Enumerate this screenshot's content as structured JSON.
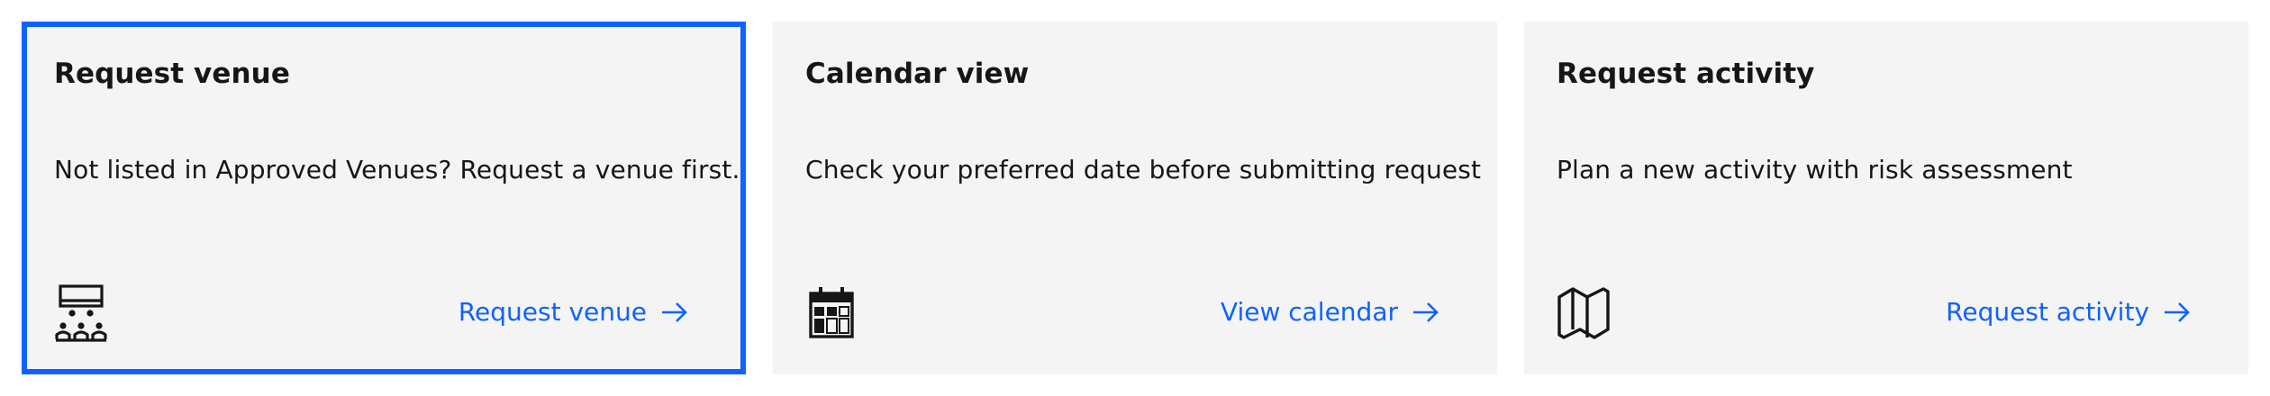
{
  "tiles": [
    {
      "title": "Request venue",
      "description": "Not listed in Approved Venues? Request a venue first.",
      "link_label": "Request venue",
      "icon": "presentation-audience-icon",
      "focused": true
    },
    {
      "title": "Calendar view",
      "description": "Check your preferred date before submitting request",
      "link_label": "View calendar",
      "icon": "calendar-icon",
      "focused": false
    },
    {
      "title": "Request activity",
      "description": "Plan a new activity with risk assessment",
      "link_label": "Request activity",
      "icon": "map-icon",
      "focused": false
    }
  ],
  "colors": {
    "tile_background": "#f4f4f4",
    "focus_border": "#0f62fe",
    "link": "#0f62fe",
    "text": "#161616"
  }
}
